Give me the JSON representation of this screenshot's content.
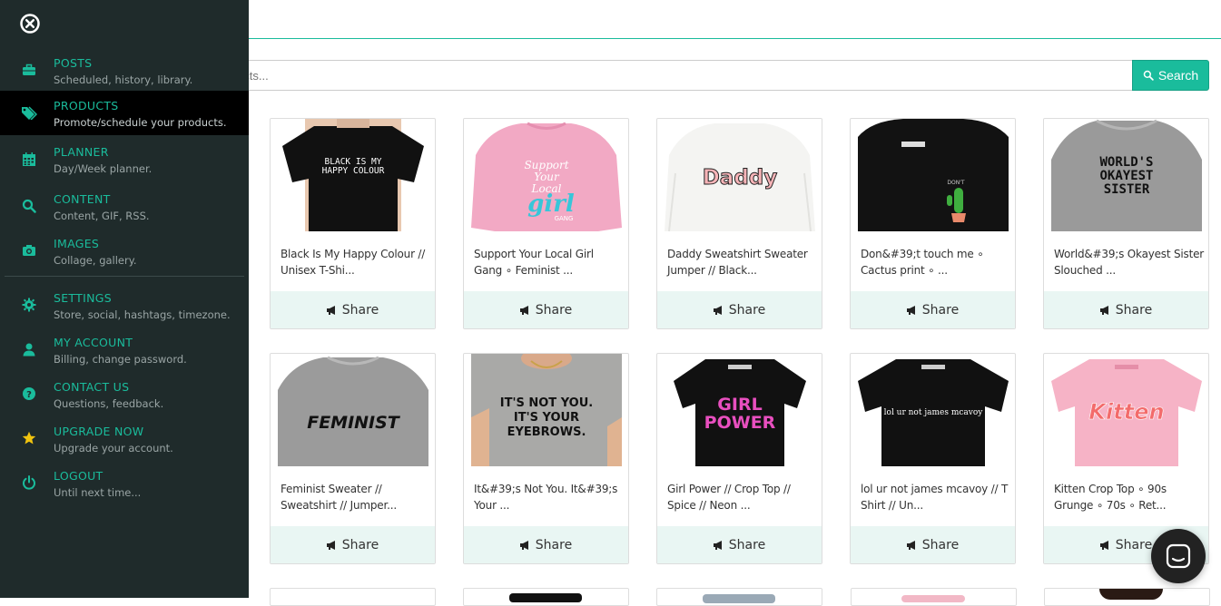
{
  "search": {
    "placeholder": "ucts...",
    "button_label": "Search"
  },
  "sidebar": {
    "items": [
      {
        "label": "POSTS",
        "sub": "Scheduled, history, library.",
        "icon": "briefcase-icon"
      },
      {
        "label": "PRODUCTS",
        "sub": "Promote/schedule your products.",
        "icon": "tags-icon"
      },
      {
        "label": "PLANNER",
        "sub": "Day/Week planner.",
        "icon": "calendar-icon"
      },
      {
        "label": "CONTENT",
        "sub": "Content, GIF, RSS.",
        "icon": "search-icon"
      },
      {
        "label": "IMAGES",
        "sub": "Collage, gallery.",
        "icon": "camera-icon"
      },
      {
        "label": "SETTINGS",
        "sub": "Store, social, hashtags, timezone.",
        "icon": "gear-icon"
      },
      {
        "label": "MY ACCOUNT",
        "sub": "Billing, change password.",
        "icon": "user-icon"
      },
      {
        "label": "CONTACT US",
        "sub": "Questions, feedback.",
        "icon": "question-icon"
      },
      {
        "label": "UPGRADE NOW",
        "sub": "Upgrade your account.",
        "icon": "star-icon"
      },
      {
        "label": "LOGOUT",
        "sub": "Until next time...",
        "icon": "power-icon"
      }
    ]
  },
  "products": [
    {
      "title": "Black Is My Happy Colour // Unisex T-Shi...",
      "share": "Share",
      "thumb_text": "BLACK IS MY HAPPY COLOUR"
    },
    {
      "title": "Support Your Local Girl Gang ∘ Feminist ...",
      "share": "Share",
      "thumb_text": "Support Your Local girl GANG"
    },
    {
      "title": "Daddy Sweatshirt Sweater Jumper // Black...",
      "share": "Share",
      "thumb_text": "Daddy"
    },
    {
      "title": "Don&#39;t touch me ∘ Cactus print ∘ ...",
      "share": "Share",
      "thumb_text": "DON'T TOUCH ME"
    },
    {
      "title": "World&#39;s Okayest Sister Slouched ...",
      "share": "Share",
      "thumb_text": "WORLD'S OKAYEST SISTER"
    },
    {
      "title": "Feminist Sweater // Sweatshirt // Jumper...",
      "share": "Share",
      "thumb_text": "FEMINIST"
    },
    {
      "title": "It&#39;s Not You. It&#39;s Your ...",
      "share": "Share",
      "thumb_text": "IT'S NOT YOU. IT'S YOUR EYEBROWS."
    },
    {
      "title": "Girl Power // Crop Top // Spice // Neon ...",
      "share": "Share",
      "thumb_text": "GIRL POWER"
    },
    {
      "title": "lol ur not james mcavoy // T Shirt // Un...",
      "share": "Share",
      "thumb_text": "lol ur not james mcavoy"
    },
    {
      "title": "Kitten Crop Top ∘ 90s Grunge ∘ 70s ∘ Ret...",
      "share": "Share",
      "thumb_text": "Kitten"
    }
  ],
  "colors": {
    "accent": "#1abc9c",
    "sidebar_bg": "#1f2b2b",
    "share_bg": "#e9f6f3"
  }
}
